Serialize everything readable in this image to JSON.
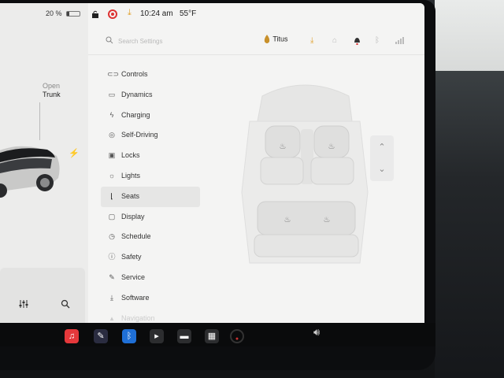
{
  "status": {
    "battery_pct": "20 %",
    "battery_level": 0.2,
    "time": "10:24 am",
    "temperature": "55°F"
  },
  "car": {
    "open_label": "Open",
    "trunk_label": "Trunk"
  },
  "search": {
    "placeholder": "Search Settings"
  },
  "profile": {
    "name": "Titus"
  },
  "menu": {
    "items": [
      {
        "label": "Controls",
        "icon": "toggle-icon"
      },
      {
        "label": "Dynamics",
        "icon": "car-icon"
      },
      {
        "label": "Charging",
        "icon": "bolt-icon"
      },
      {
        "label": "Self-Driving",
        "icon": "steering-wheel-icon"
      },
      {
        "label": "Locks",
        "icon": "lock-icon"
      },
      {
        "label": "Lights",
        "icon": "sun-icon"
      },
      {
        "label": "Seats",
        "icon": "seat-icon"
      },
      {
        "label": "Display",
        "icon": "display-icon"
      },
      {
        "label": "Schedule",
        "icon": "clock-icon"
      },
      {
        "label": "Safety",
        "icon": "info-icon"
      },
      {
        "label": "Service",
        "icon": "wrench-icon"
      },
      {
        "label": "Software",
        "icon": "download-icon"
      },
      {
        "label": "Navigation",
        "icon": "navigation-icon"
      }
    ],
    "active": "Seats"
  },
  "colors": {
    "accent_red": "#d33333",
    "download_orange": "#e0a02b",
    "bluetooth_blue": "#1f6fd6",
    "music_red": "#e5383b"
  }
}
